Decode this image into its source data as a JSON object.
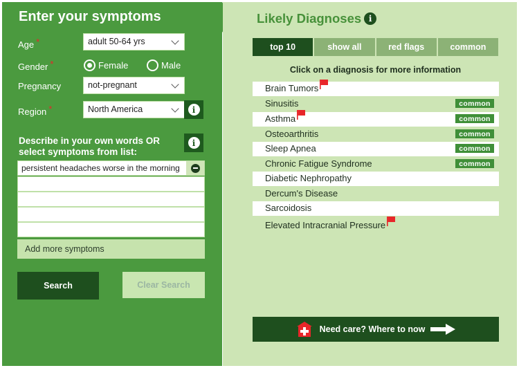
{
  "symptom_panel": {
    "title": "Enter your symptoms",
    "age": {
      "label": "Age",
      "value": "adult 50-64 yrs"
    },
    "gender": {
      "label": "Gender",
      "options": [
        "Female",
        "Male"
      ],
      "selected": "Female"
    },
    "pregnancy": {
      "label": "Pregnancy",
      "value": "not-pregnant"
    },
    "region": {
      "label": "Region",
      "value": "North America"
    },
    "required_mark": "*",
    "describe_label": "Describe in your own words OR select symptoms from list:",
    "symptoms": [
      "persistent headaches worse in the morning",
      "",
      "",
      "",
      ""
    ],
    "add_more_label": "Add more symptoms",
    "search_label": "Search",
    "clear_label": "Clear Search"
  },
  "diagnoses_panel": {
    "title": "Likely Diagnoses",
    "tabs": [
      {
        "label": "top 10",
        "active": true
      },
      {
        "label": "show all",
        "active": false
      },
      {
        "label": "red flags",
        "active": false
      },
      {
        "label": "common",
        "active": false
      }
    ],
    "hint": "Click on a diagnosis for more information",
    "items": [
      {
        "name": "Brain Tumors",
        "red_flag": true,
        "badge": ""
      },
      {
        "name": "Sinusitis",
        "red_flag": false,
        "badge": "common"
      },
      {
        "name": "Asthma",
        "red_flag": true,
        "badge": "common"
      },
      {
        "name": "Osteoarthritis",
        "red_flag": false,
        "badge": "common"
      },
      {
        "name": "Sleep Apnea",
        "red_flag": false,
        "badge": "common"
      },
      {
        "name": "Chronic Fatigue Syndrome",
        "red_flag": false,
        "badge": "common"
      },
      {
        "name": "Diabetic Nephropathy",
        "red_flag": false,
        "badge": ""
      },
      {
        "name": "Dercum's Disease",
        "red_flag": false,
        "badge": ""
      },
      {
        "name": "Sarcoidosis",
        "red_flag": false,
        "badge": ""
      },
      {
        "name": "Elevated Intracranial Pressure",
        "red_flag": true,
        "badge": ""
      }
    ],
    "care_label": "Need care?  Where to now"
  },
  "icons": {
    "info": "info-icon",
    "flag": "red-flag-icon",
    "remove": "remove-symptom-icon",
    "hospital": "hospital-icon",
    "arrow": "arrow-right-icon"
  },
  "colors": {
    "left_bg": "#4b9a3f",
    "right_bg": "#cde5b5",
    "dark_green": "#1e4f1e",
    "title_green": "#47913a",
    "flag_red": "#e8262a"
  }
}
